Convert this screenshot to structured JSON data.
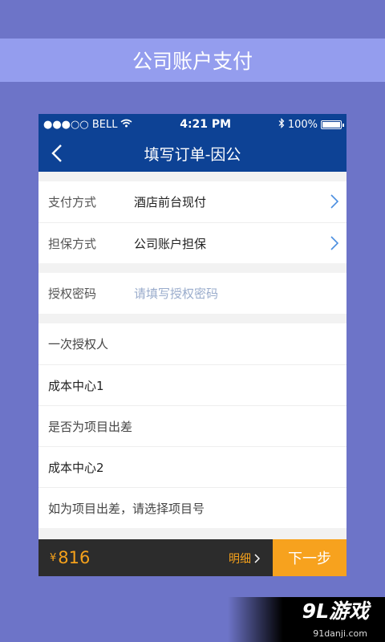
{
  "banner": {
    "title": "公司账户支付"
  },
  "status_bar": {
    "carrier": "●●●○○ BELL",
    "time": "4:21 PM",
    "battery": "100%",
    "battery_level": 1.0
  },
  "nav": {
    "title": "填写订单-因公"
  },
  "payment": {
    "method_label": "支付方式",
    "method_value": "酒店前台现付",
    "guarantee_label": "担保方式",
    "guarantee_value": "公司账户担保"
  },
  "auth": {
    "label": "授权密码",
    "placeholder": "请填写授权密码"
  },
  "details": {
    "row1": "一次授权人",
    "row2": "成本中心1",
    "row3": "是否为项目出差",
    "row4": "成本中心2",
    "row5": "如为项目出差，请选择项目号"
  },
  "footer": {
    "currency": "¥",
    "price": "816",
    "detail_label": "明细",
    "next_label": "下一步"
  },
  "watermark": {
    "logo": "9L游戏",
    "url": "91danji.com"
  },
  "colors": {
    "background": "#6d74c8",
    "banner": "#949dee",
    "nav": "#0d4295",
    "accent": "#f7a21e",
    "footer": "#2c2c2c"
  }
}
